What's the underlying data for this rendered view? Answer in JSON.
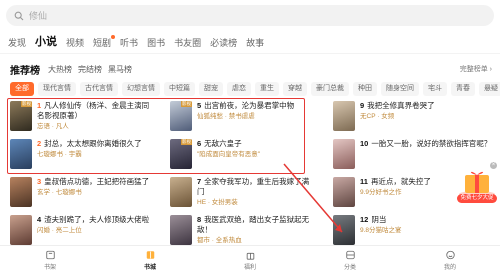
{
  "search": {
    "placeholder": "修仙"
  },
  "top_tabs": [
    {
      "label": "发现",
      "active": false,
      "dot": false
    },
    {
      "label": "小说",
      "active": true,
      "dot": false
    },
    {
      "label": "视频",
      "active": false,
      "dot": false
    },
    {
      "label": "短剧",
      "active": false,
      "dot": true
    },
    {
      "label": "听书",
      "active": false,
      "dot": false
    },
    {
      "label": "图书",
      "active": false,
      "dot": false
    },
    {
      "label": "书友圈",
      "active": false,
      "dot": false
    },
    {
      "label": "必读榜",
      "active": false,
      "dot": false
    },
    {
      "label": "故事",
      "active": false,
      "dot": false
    }
  ],
  "ranking": {
    "title": "推荐榜",
    "subtabs": [
      "大热榜",
      "完结榜",
      "黑马榜"
    ],
    "more_label": "完整榜单 ›"
  },
  "categories": [
    {
      "label": "全部",
      "active": true
    },
    {
      "label": "现代言情",
      "active": false
    },
    {
      "label": "古代言情",
      "active": false
    },
    {
      "label": "幻想言情",
      "active": false
    },
    {
      "label": "中短篇",
      "active": false
    },
    {
      "label": "甜宠",
      "active": false
    },
    {
      "label": "虐恋",
      "active": false
    },
    {
      "label": "重生",
      "active": false
    },
    {
      "label": "穿越",
      "active": false
    },
    {
      "label": "豪门总裁",
      "active": false
    },
    {
      "label": "种田",
      "active": false
    },
    {
      "label": "随身空间",
      "active": false
    },
    {
      "label": "宅斗",
      "active": false
    },
    {
      "label": "青春",
      "active": false
    },
    {
      "label": "悬疑",
      "active": false
    }
  ],
  "books": [
    {
      "num": "1",
      "title": "凡人修仙传（杨洋、金晨主演同名影视原著）",
      "meta": "忘语 · 凡人",
      "cover": [
        "#8d7a5a",
        "#2f2a1f"
      ],
      "tag": "影视"
    },
    {
      "num": "2",
      "title": "封总，太太想跟你离婚很久了",
      "meta": "七璇娜书 · 宇霸",
      "cover": [
        "#5d86b8",
        "#2a3f5e"
      ],
      "tag": ""
    },
    {
      "num": "3",
      "title": "皇叔借点功德，王妃把符画猛了",
      "meta": "玄学 · 七璇娜书",
      "cover": [
        "#b7825f",
        "#4b3324"
      ],
      "tag": ""
    },
    {
      "num": "4",
      "title": "渣夫别跪了，夫人修顶级大佬啦",
      "meta": "闪婚 · 亮二上位",
      "cover": [
        "#c9a18e",
        "#5d3b32"
      ],
      "tag": ""
    },
    {
      "num": "5",
      "title": "出宫前夜，沦为暴君掌中物",
      "meta": "仙狐纯愁 · 禁书虐虐",
      "cover": [
        "#c4ccd8",
        "#4f5c78"
      ],
      "tag": "影视"
    },
    {
      "num": "6",
      "title": "无敌六皇子",
      "meta": "\"陷成面向皇帝有恶意\"",
      "cover": [
        "#6d6b7f",
        "#262435"
      ],
      "tag": "影视"
    },
    {
      "num": "7",
      "title": "全家夺我军功，重生后我嫁了满门",
      "meta": "HE · 女扮男装",
      "cover": [
        "#c8b08f",
        "#6b5336"
      ],
      "tag": ""
    },
    {
      "num": "8",
      "title": "我医武双绝，踏出女子监狱起无敌！",
      "meta": "都市 · 全系热血",
      "cover": [
        "#9b8f98",
        "#3d3440"
      ],
      "tag": ""
    },
    {
      "num": "9",
      "title": "我把全修真界卷哭了",
      "meta": "无CP · 女频",
      "cover": [
        "#d8c7b0",
        "#7d6a52"
      ],
      "tag": ""
    },
    {
      "num": "10",
      "title": "一胎又一胎，说好的禁欲指挥官呢？",
      "meta": "",
      "cover": [
        "#e4c7c4",
        "#8a5d5a"
      ],
      "tag": ""
    },
    {
      "num": "11",
      "title": "再近点，就失控了",
      "meta": "9.9分好书之作",
      "cover": [
        "#c9a9a4",
        "#5e4540"
      ],
      "tag": ""
    },
    {
      "num": "12",
      "title": "阴当",
      "meta": "9.8分猫咕之宴",
      "cover": [
        "#777b80",
        "#2c2f33"
      ],
      "tag": ""
    }
  ],
  "float_badge": {
    "label": "免费七夕大促"
  },
  "bottom_nav": [
    {
      "label": "书架",
      "icon": "bookshelf-icon",
      "active": false
    },
    {
      "label": "书城",
      "icon": "bookstore-icon",
      "active": true
    },
    {
      "label": "福利",
      "icon": "gift-icon",
      "active": false
    },
    {
      "label": "分类",
      "icon": "category-icon",
      "active": false
    },
    {
      "label": "我的",
      "icon": "profile-icon",
      "active": false
    }
  ],
  "colors": {
    "accent": "#ff6a2b",
    "highlight": "#e53935"
  }
}
